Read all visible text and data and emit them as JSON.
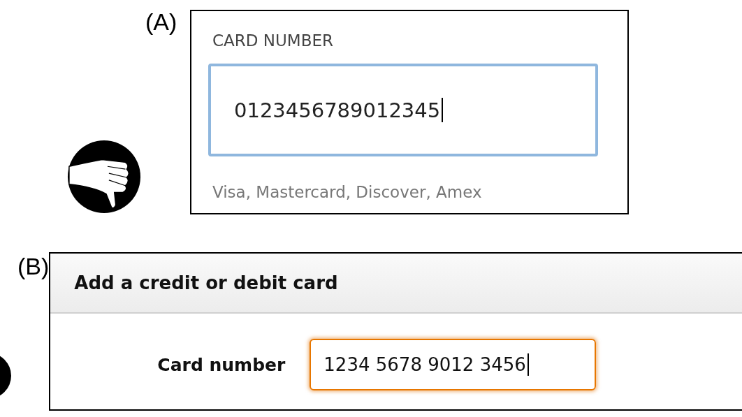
{
  "panel_a": {
    "label": "(A)",
    "field_label": "CARD NUMBER",
    "value": "0123456789012345",
    "focused": true,
    "hint": "Visa, Mastercard, Discover, Amex"
  },
  "panel_b": {
    "label": "(B)",
    "title": "Add a credit or debit card",
    "field_label": "Card number",
    "value": "1234 5678 9012 3456",
    "focused": true
  }
}
